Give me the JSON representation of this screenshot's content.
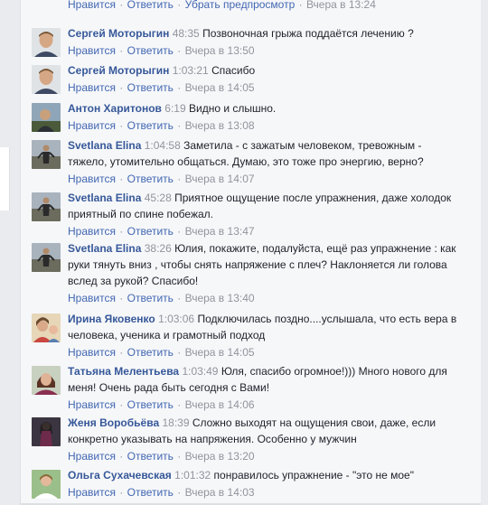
{
  "top_actions": {
    "like": "Нравится",
    "reply": "Ответить",
    "remove_preview": "Убрать предпросмотр",
    "time": "Вчера в 13:24"
  },
  "comments": [
    {
      "author": "Сергей Моторыгин",
      "ts": "48:35",
      "text": "Позвоночная грыжа поддаётся лечению ?",
      "like": "Нравится",
      "reply": "Ответить",
      "time": "Вчера в 13:50",
      "avatar": "avatar-sergey"
    },
    {
      "author": "Сергей Моторыгин",
      "ts": "1:03:21",
      "text": "Спасибо",
      "like": "Нравится",
      "reply": "Ответить",
      "time": "Вчера в 14:05",
      "avatar": "avatar-sergey"
    },
    {
      "author": "Антон Харитонов",
      "ts": "6:19",
      "text": "Видно и слышно.",
      "like": "Нравится",
      "reply": "Ответить",
      "time": "Вчера в 13:08",
      "avatar": "avatar-anton"
    },
    {
      "author": "Svetlana Elina",
      "ts": "1:04:58",
      "text": "Заметила - с зажатым человеком, тревожным - тяжело, утомительно общаться. Думаю, это тоже про энергию, верно?",
      "like": "Нравится",
      "reply": "Ответить",
      "time": "Вчера в 14:07",
      "avatar": "avatar-svetlana"
    },
    {
      "author": "Svetlana Elina",
      "ts": "45:28",
      "text": "Приятное ощущение после упражнения, даже холодок приятный по спине побежал.",
      "like": "Нравится",
      "reply": "Ответить",
      "time": "Вчера в 13:47",
      "avatar": "avatar-svetlana"
    },
    {
      "author": "Svetlana Elina",
      "ts": "38:26",
      "text": "Юлия, покажите, подалуйста, ещё раз упражнение : как руки тянуть вниз , чтобы снять напряжение с плеч? Наклоняется ли голова вслед за рукой? Спасибо!",
      "like": "Нравится",
      "reply": "Ответить",
      "time": "Вчера в 13:40",
      "avatar": "avatar-svetlana"
    },
    {
      "author": "Ирина Яковенко",
      "ts": "1:03:06",
      "text": "Подключилась поздно....услышала, что есть вера в человека, ученика и грамотный подход",
      "like": "Нравится",
      "reply": "Ответить",
      "time": "Вчера в 14:05",
      "avatar": "avatar-irina"
    },
    {
      "author": "Татьяна Мелентьева",
      "ts": "1:03:49",
      "text": "Юля, спасибо огромное!))) Много нового для меня! Очень рада быть сегодня с Вами!",
      "like": "Нравится",
      "reply": "Ответить",
      "time": "Вчера в 14:06",
      "avatar": "avatar-tatiana"
    },
    {
      "author": "Женя Воробьёва",
      "ts": "18:39",
      "text": "Сложно выходят на ощущения свои, даже, если конкретно указывать на напряжения. Особенно у мужчин",
      "like": "Нравится",
      "reply": "Ответить",
      "time": "Вчера в 13:20",
      "avatar": "avatar-zhenya"
    },
    {
      "author": "Ольга Сухачевская",
      "ts": "1:01:32",
      "text": "понравилось упражнение - \"это не мое\"",
      "like": "Нравится",
      "reply": "Ответить",
      "time": "Вчера в 14:03",
      "avatar": "avatar-olga"
    }
  ]
}
